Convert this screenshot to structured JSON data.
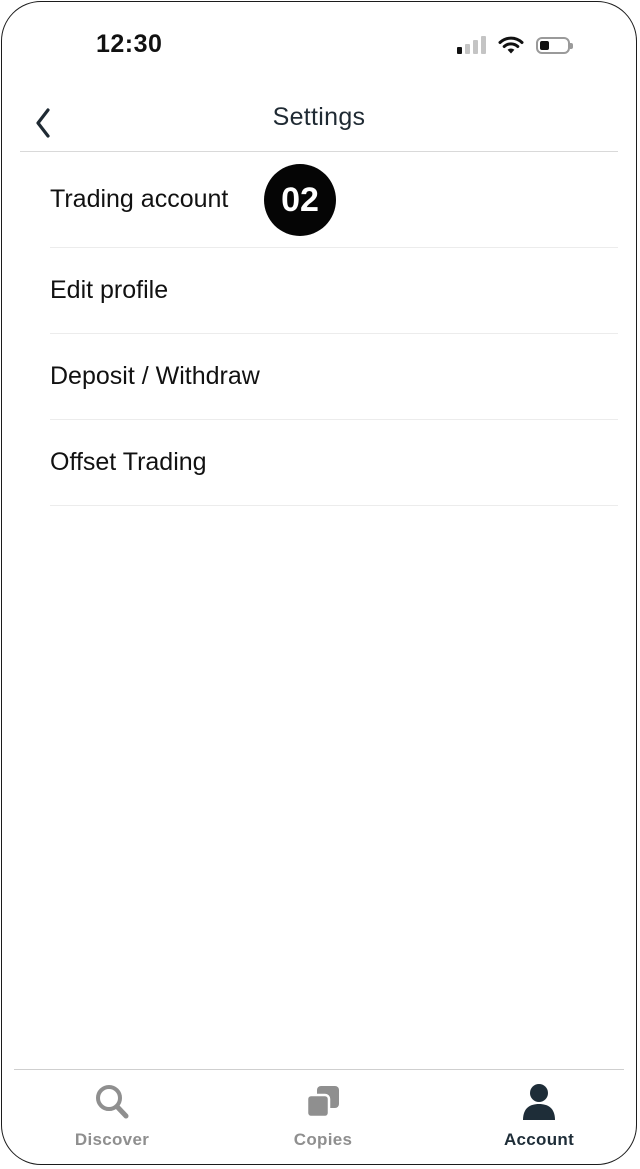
{
  "status_bar": {
    "time": "12:30",
    "signal_bars_active": 1,
    "battery_level": 0.35
  },
  "header": {
    "title": "Settings",
    "back_icon": "chevron-left-icon"
  },
  "menu": {
    "items": [
      {
        "label": "Trading account",
        "badge": "02"
      },
      {
        "label": "Edit profile"
      },
      {
        "label": "Deposit / Withdraw"
      },
      {
        "label": "Offset Trading"
      }
    ]
  },
  "tab_bar": {
    "tabs": [
      {
        "label": "Discover",
        "icon": "search-icon",
        "active": false
      },
      {
        "label": "Copies",
        "icon": "copies-icon",
        "active": false
      },
      {
        "label": "Account",
        "icon": "person-icon",
        "active": true
      }
    ]
  },
  "colors": {
    "active_tab": "#1e2d38",
    "inactive_tab": "#8f8f8f",
    "badge_background": "#050505",
    "divider": "#d9d9d9"
  }
}
